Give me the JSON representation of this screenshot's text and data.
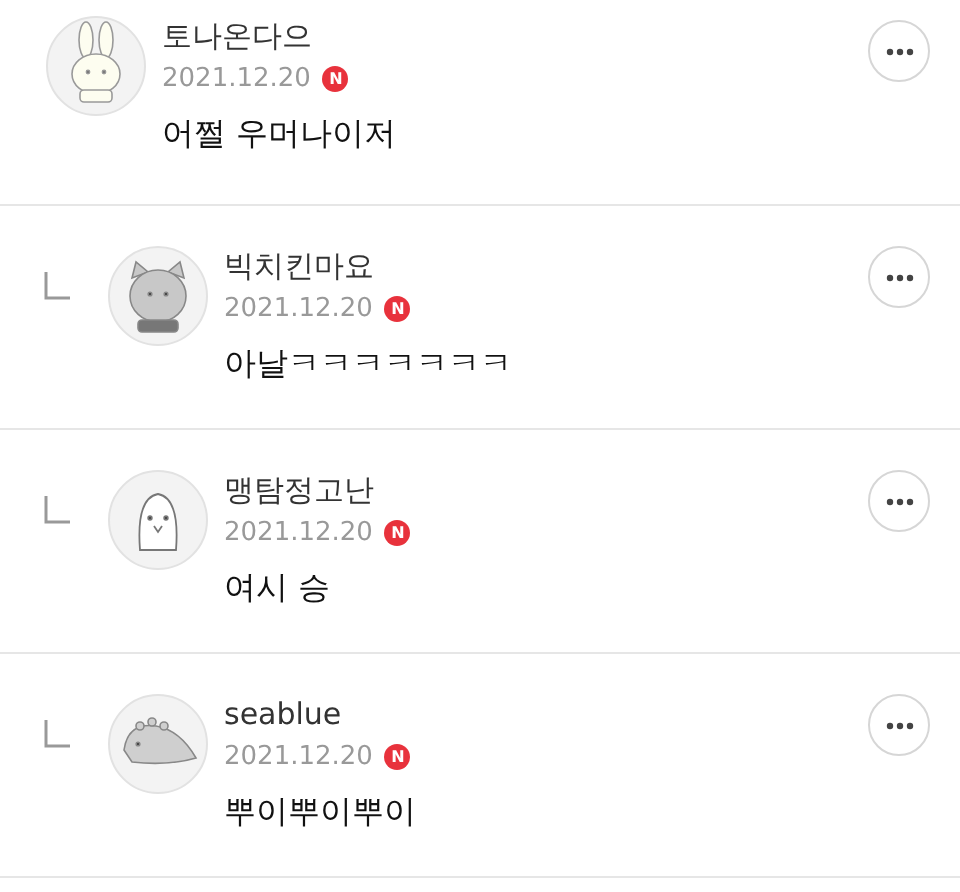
{
  "comments": [
    {
      "kind": "comment",
      "avatar": {
        "kind": "rabbit"
      },
      "author": "토나온다으",
      "date": "2021.12.20",
      "badge": "N",
      "text": "어쩔 우머나이저"
    },
    {
      "kind": "reply",
      "avatar": {
        "kind": "cat"
      },
      "author": "빅치킨마요",
      "date": "2021.12.20",
      "badge": "N",
      "text": "아날ㅋㅋㅋㅋㅋㅋㅋ"
    },
    {
      "kind": "reply",
      "avatar": {
        "kind": "penguin"
      },
      "author": "맹탐정고난",
      "date": "2021.12.20",
      "badge": "N",
      "text": "여시 승"
    },
    {
      "kind": "reply",
      "avatar": {
        "kind": "dino"
      },
      "author": "seablue",
      "date": "2021.12.20",
      "badge": "N",
      "text": "뿌이뿌이뿌이"
    }
  ]
}
